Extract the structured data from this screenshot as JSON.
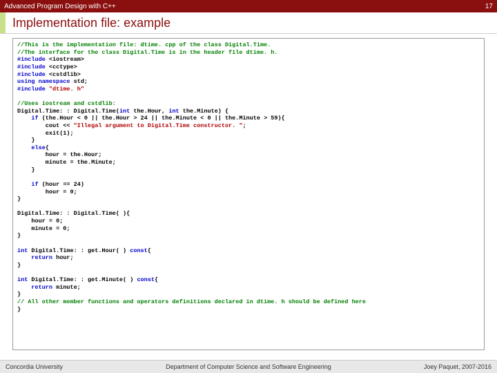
{
  "header": {
    "course": "Advanced Program Design with C++",
    "page_number": "17"
  },
  "title": "Implementation file: example",
  "code": {
    "l01": "//This is the implementation file: dtime. cpp of the class Digital.Time.",
    "l02": "//The interface for the class Digital.Time is in the header file dtime. h.",
    "l03a": "#include ",
    "l03b": "<iostream>",
    "l04a": "#include ",
    "l04b": "<cctype>",
    "l05a": "#include ",
    "l05b": "<cstdlib>",
    "l06a": "using namespace ",
    "l06b": "std;",
    "l07a": "#include ",
    "l07b": "\"dtime. h\"",
    "l08": "//Uses iostream and cstdlib:",
    "l09a": "Digital.Time: : Digital.Time(",
    "l09b": "int",
    "l09c": " the.Hour, ",
    "l09d": "int",
    "l09e": " the.Minute) {",
    "l10a": "    ",
    "l10b": "if",
    "l10c": " (the.Hour < 0 || the.Hour > 24 || the.Minute < 0 || the.Minute > 59){",
    "l11a": "        cout << ",
    "l11b": "\"Illegal argument to Digital.Time constructor. \"",
    "l11c": ";",
    "l12": "        exit(1);",
    "l13": "    }",
    "l14a": "    ",
    "l14b": "else",
    "l14c": "{",
    "l15": "        hour = the.Hour;",
    "l16": "        minute = the.Minute;",
    "l17": "    }",
    "l18a": "    ",
    "l18b": "if",
    "l18c": " (hour == 24)",
    "l19": "        hour = 0;",
    "l20": "}",
    "l21": "Digital.Time: : Digital.Time( ){",
    "l22": "    hour = 0;",
    "l23": "    minute = 0;",
    "l24": "}",
    "l25a": "int",
    "l25b": " Digital.Time: : get.Hour( ) ",
    "l25c": "const",
    "l25d": "{",
    "l26a": "    ",
    "l26b": "return",
    "l26c": " hour;",
    "l27": "}",
    "l28a": "int",
    "l28b": " Digital.Time: : get.Minute( ) ",
    "l28c": "const",
    "l28d": "{",
    "l29a": "    ",
    "l29b": "return",
    "l29c": " minute;",
    "l30": "}",
    "l31": "// All other member functions and operators definitions declared in dtime. h should be defined here",
    "l32": "}"
  },
  "footer": {
    "left": "Concordia University",
    "center": "Department of Computer Science and Software Engineering",
    "right": "Joey Paquet, 2007-2016"
  }
}
